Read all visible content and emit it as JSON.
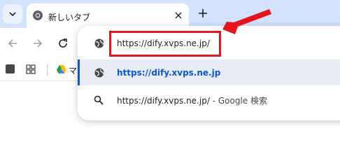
{
  "tab": {
    "title": "新しいタブ"
  },
  "omnibox": {
    "input_value": "https://dify.xvps.ne.jp/"
  },
  "suggestions": [
    {
      "text": "https://dify.xvps.ne.jp"
    },
    {
      "text": "https://dify.xvps.ne.jp/",
      "suffix": "- Google 検索"
    }
  ],
  "bookmarks": {
    "first_label": "マ"
  },
  "colors": {
    "highlight": "#e4161b",
    "accent": "#0b57d0",
    "tabstrip": "#d3e3fd"
  },
  "icons": [
    "tab-list-icon",
    "chrome-favicon-icon",
    "close-icon",
    "plus-icon",
    "back-icon",
    "forward-icon",
    "reload-icon",
    "globe-icon",
    "search-icon",
    "apps-icon",
    "drive-icon"
  ]
}
